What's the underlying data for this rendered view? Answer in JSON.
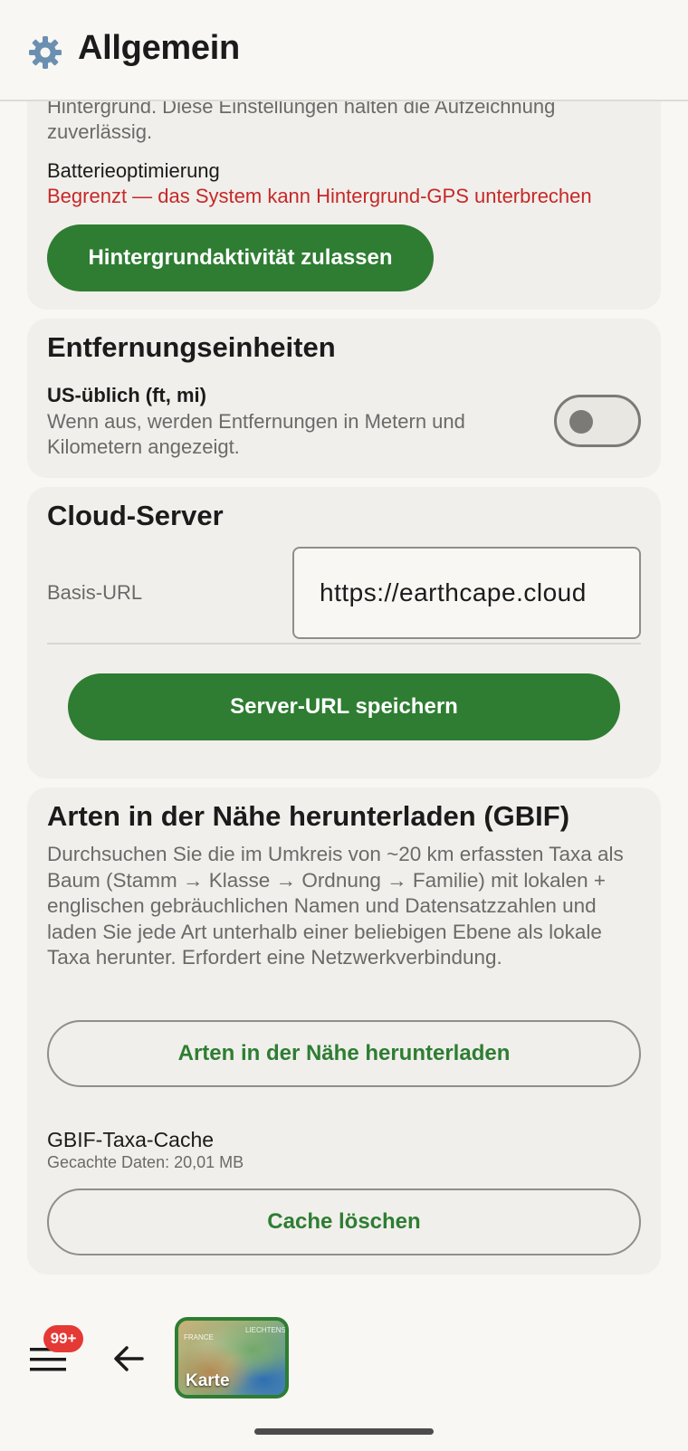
{
  "header": {
    "title": "Allgemein",
    "icon": "gear-icon"
  },
  "background_card": {
    "intro_text": "Hintergrund. Diese Einstellungen halten die Aufzeichnung zuverlässig.",
    "battery_label": "Batterieoptimierung",
    "battery_status": "Begrenzt — das System kann Hintergrund-GPS unterbrechen",
    "allow_button": "Hintergrundaktivität zulassen"
  },
  "units_card": {
    "title": "Entfernungseinheiten",
    "toggle_label": "US-üblich (ft, mi)",
    "toggle_desc": "Wenn aus, werden Entfernungen in Metern und Kilometern angezeigt.",
    "toggle_on": false
  },
  "cloud_card": {
    "title": "Cloud-Server",
    "url_label": "Basis-URL",
    "url_value": "https://earthcape.cloud",
    "save_button": "Server-URL speichern"
  },
  "gbif_card": {
    "title": "Arten in der Nähe herunterladen (GBIF)",
    "description": "Durchsuchen Sie die im Umkreis von ~20 km erfassten Taxa als Baum (Stamm → Klasse → Ordnung → Familie) mit lokalen + englischen gebräuchlichen Namen und Datensatzzahlen und laden Sie jede Art unterhalb einer beliebigen Ebene als lokale Taxa herunter. Erfordert eine Netzwerkverbindung.",
    "download_button": "Arten in der Nähe herunterladen",
    "cache_title": "GBIF-Taxa-Cache",
    "cache_size": "Gecachte Daten: 20,01 MB",
    "clear_button": "Cache löschen"
  },
  "bottom_nav": {
    "menu_badge": "99+",
    "map_label": "Karte",
    "map_texts": [
      "FRANCE",
      "LIECHTENS"
    ]
  },
  "colors": {
    "accent": "#2e7d32",
    "warning": "#c62828",
    "badge": "#e53935"
  }
}
